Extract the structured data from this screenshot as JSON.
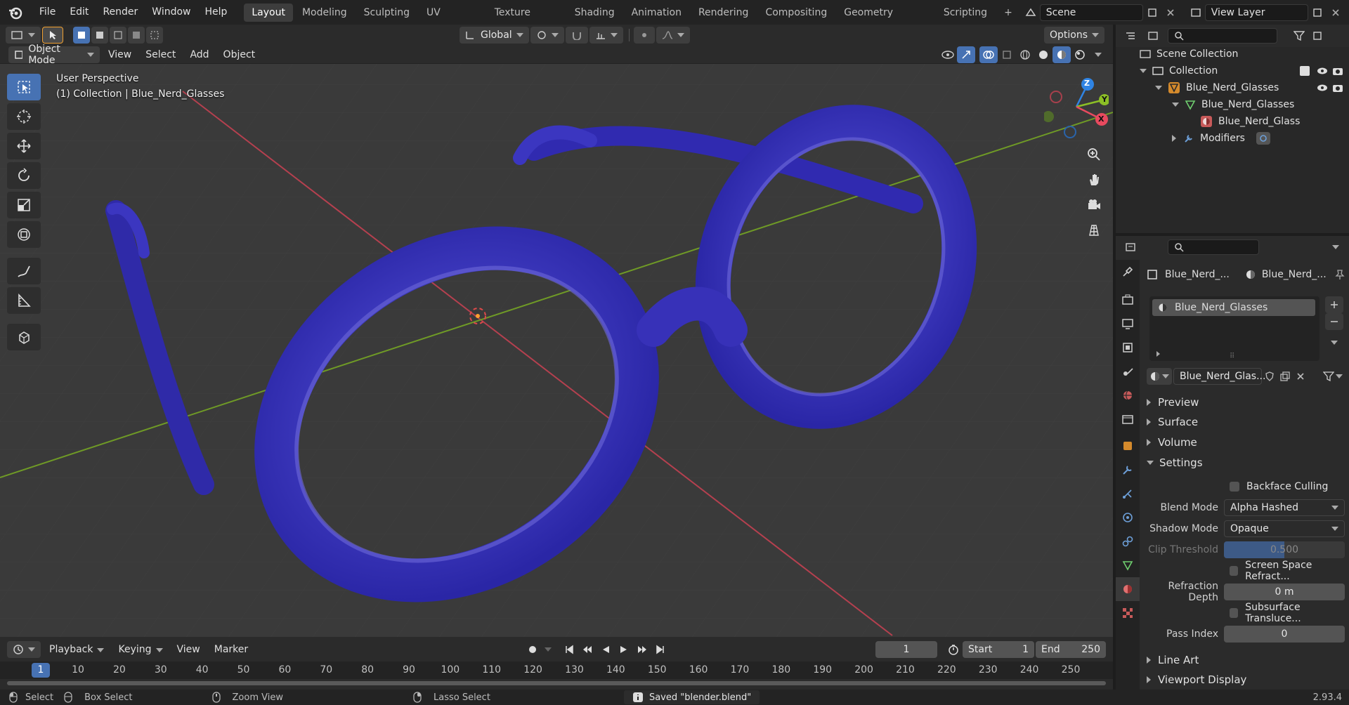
{
  "topbar": {
    "menus": [
      "File",
      "Edit",
      "Render",
      "Window",
      "Help"
    ],
    "workspaces": [
      "Layout",
      "Modeling",
      "Sculpting",
      "UV Editing",
      "Texture Paint",
      "Shading",
      "Animation",
      "Rendering",
      "Compositing",
      "Geometry Nodes",
      "Scripting"
    ],
    "scene": "Scene",
    "view_layer": "View Layer",
    "add_tab": "+"
  },
  "viewport": {
    "transform_orientation": "Global",
    "options_label": "Options",
    "mode": "Object Mode",
    "menus": [
      "View",
      "Select",
      "Add",
      "Object"
    ],
    "info_line1": "User Perspective",
    "info_line2": "(1) Collection | Blue_Nerd_Glasses",
    "gizmo": {
      "x": "X",
      "y": "Y",
      "z": "Z"
    }
  },
  "timeline": {
    "menus": [
      "Playback",
      "Keying",
      "View",
      "Marker"
    ],
    "current_frame": "1",
    "start_label": "Start",
    "start_value": "1",
    "end_label": "End",
    "end_value": "250",
    "ruler_ticks": [
      "1",
      "10",
      "20",
      "30",
      "40",
      "50",
      "60",
      "70",
      "80",
      "90",
      "100",
      "110",
      "120",
      "130",
      "140",
      "150",
      "160",
      "170",
      "180",
      "190",
      "200",
      "210",
      "220",
      "230",
      "240",
      "250"
    ]
  },
  "status": {
    "select": "Select",
    "box_select": "Box Select",
    "zoom_view": "Zoom View",
    "lasso_select": "Lasso Select",
    "message": "Saved \"blender.blend\"",
    "version": "2.93.4"
  },
  "outliner": {
    "rows": [
      {
        "label": "Scene Collection"
      },
      {
        "label": "Collection"
      },
      {
        "label": "Blue_Nerd_Glasses"
      },
      {
        "label": "Blue_Nerd_Glasses"
      },
      {
        "label": "Blue_Nerd_Glass"
      },
      {
        "label": "Modifiers"
      }
    ]
  },
  "properties": {
    "object_crumb": "Blue_Nerd_...",
    "material_crumb": "Blue_Nerd_...",
    "slot": "Blue_Nerd_Glasses",
    "material_name": "Blue_Nerd_Glas...",
    "sections_collapsed_top": [
      "Preview",
      "Surface",
      "Volume"
    ],
    "settings_label": "Settings",
    "backface_culling": "Backface Culling",
    "blend_mode_label": "Blend Mode",
    "blend_mode_value": "Alpha Hashed",
    "shadow_mode_label": "Shadow Mode",
    "shadow_mode_value": "Opaque",
    "clip_threshold_label": "Clip Threshold",
    "clip_threshold_value": "0.500",
    "screen_space_refraction": "Screen Space Refract...",
    "refraction_depth_label": "Refraction Depth",
    "refraction_depth_value": "0 m",
    "subsurface_translucency": "Subsurface Transluce...",
    "pass_index_label": "Pass Index",
    "pass_index_value": "0",
    "sections_collapsed_bottom": [
      "Line Art",
      "Viewport Display"
    ]
  },
  "colors": {
    "accent": "#4772b3",
    "glasses": "#3a35c4",
    "x_axis": "#e84a5f",
    "y_axis": "#8cbf26",
    "z_axis": "#2f84e4"
  }
}
